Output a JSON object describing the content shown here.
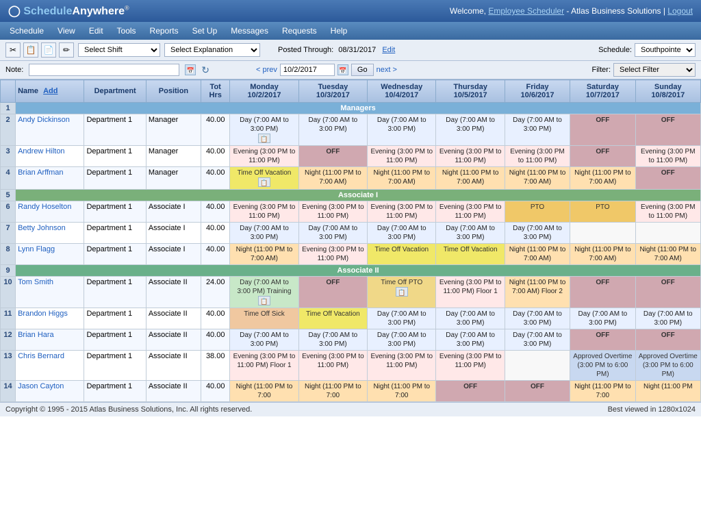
{
  "app": {
    "title": "Schedule Anywhere",
    "logo_text": "Schedule",
    "logo_highlight": "Anywhere",
    "logo_symbol": "®"
  },
  "header": {
    "welcome": "Welcome,",
    "user_link": "Employee Scheduler",
    "company": "- Atlas Business Solutions |",
    "logout": "Logout"
  },
  "nav": {
    "items": [
      "Schedule",
      "View",
      "Edit",
      "Tools",
      "Reports",
      "Set Up",
      "Messages",
      "Requests",
      "Help"
    ]
  },
  "toolbar": {
    "shift_placeholder": "Select Shift",
    "explanation_placeholder": "Select Explanation",
    "posted_label": "Posted Through:",
    "posted_date": "08/31/2017",
    "edit_link": "Edit",
    "schedule_label": "Schedule:",
    "schedule_value": "Southpointe",
    "filter_label": "Filter:",
    "filter_value": "Select Filter"
  },
  "date_nav": {
    "prev": "< prev",
    "current_date": "10/2/2017",
    "go": "Go",
    "next": "next >"
  },
  "note": {
    "label": "Note:"
  },
  "table": {
    "headers": {
      "row_num": "",
      "name": "Name",
      "add": "Add",
      "department": "Department",
      "position": "Position",
      "tot_hrs": "Tot Hrs",
      "monday": "Monday\n10/2/2017",
      "tuesday": "Tuesday\n10/3/2017",
      "wednesday": "Wednesday\n10/4/2017",
      "thursday": "Thursday\n10/5/2017",
      "friday": "Friday\n10/6/2017",
      "saturday": "Saturday\n10/7/2017",
      "sunday": "Sunday\n10/8/2017"
    },
    "sections": [
      {
        "id": 1,
        "label": "Managers",
        "type": "managers",
        "rows": [
          {
            "num": 2,
            "name": "Andy Dickinson",
            "department": "Department 1",
            "position": "Manager",
            "tot_hrs": "40.00",
            "monday": "Day (7:00 AM to 3:00 PM)",
            "monday_type": "day",
            "monday_icon": true,
            "tuesday": "Day (7:00 AM to 3:00 PM)",
            "tuesday_type": "day",
            "wednesday": "Day (7:00 AM to 3:00 PM)",
            "wednesday_type": "day",
            "thursday": "Day (7:00 AM to 3:00 PM)",
            "thursday_type": "day",
            "friday": "Day (7:00 AM to 3:00 PM)",
            "friday_type": "day",
            "saturday": "OFF",
            "saturday_type": "off",
            "sunday": "OFF",
            "sunday_type": "off"
          },
          {
            "num": 3,
            "name": "Andrew Hilton",
            "department": "Department 1",
            "position": "Manager",
            "tot_hrs": "40.00",
            "monday": "Evening (3:00 PM to 11:00 PM)",
            "monday_type": "evening",
            "tuesday": "OFF",
            "tuesday_type": "off",
            "wednesday": "Evening (3:00 PM to 11:00 PM)",
            "wednesday_type": "evening",
            "thursday": "Evening (3:00 PM to 11:00 PM)",
            "thursday_type": "evening",
            "friday": "Evening (3:00 PM to 11:00 PM)",
            "friday_type": "evening",
            "saturday": "OFF",
            "saturday_type": "off",
            "sunday": "Evening (3:00 PM to 11:00 PM)",
            "sunday_type": "evening"
          },
          {
            "num": 4,
            "name": "Brian Arffman",
            "department": "Department 1",
            "position": "Manager",
            "tot_hrs": "40.00",
            "monday": "Time Off Vacation",
            "monday_type": "vacation",
            "monday_icon": true,
            "tuesday": "Night (11:00 PM to 7:00 AM)",
            "tuesday_type": "night",
            "wednesday": "Night (11:00 PM to 7:00 AM)",
            "wednesday_type": "night",
            "thursday": "Night (11:00 PM to 7:00 AM)",
            "thursday_type": "night",
            "friday": "Night (11:00 PM to 7:00 AM)",
            "friday_type": "night",
            "saturday": "Night (11:00 PM to 7:00 AM)",
            "saturday_type": "night",
            "sunday": "OFF",
            "sunday_type": "off"
          }
        ]
      },
      {
        "id": 5,
        "label": "Associate I",
        "type": "associate1",
        "rows": [
          {
            "num": 6,
            "name": "Randy Hoselton",
            "department": "Department 1",
            "position": "Associate I",
            "tot_hrs": "40.00",
            "monday": "Evening (3:00 PM to 11:00 PM)",
            "monday_type": "evening",
            "tuesday": "Evening (3:00 PM to 11:00 PM)",
            "tuesday_type": "evening",
            "wednesday": "Evening (3:00 PM to 11:00 PM)",
            "wednesday_type": "evening",
            "thursday": "Evening (3:00 PM to 11:00 PM)",
            "thursday_type": "evening",
            "friday": "PTO",
            "friday_type": "pto",
            "saturday": "PTO",
            "saturday_type": "pto",
            "sunday": "Evening (3:00 PM to 11:00 PM)",
            "sunday_type": "evening"
          },
          {
            "num": 7,
            "name": "Betty Johnson",
            "department": "Department 1",
            "position": "Associate I",
            "tot_hrs": "40.00",
            "monday": "Day (7:00 AM to 3:00 PM)",
            "monday_type": "day",
            "tuesday": "Day (7:00 AM to 3:00 PM)",
            "tuesday_type": "day",
            "wednesday": "Day (7:00 AM to 3:00 PM)",
            "wednesday_type": "day",
            "thursday": "Day (7:00 AM to 3:00 PM)",
            "thursday_type": "day",
            "friday": "Day (7:00 AM to 3:00 PM)",
            "friday_type": "day",
            "saturday": "",
            "saturday_type": "empty",
            "sunday": "",
            "sunday_type": "empty"
          },
          {
            "num": 8,
            "name": "Lynn Flagg",
            "department": "Department 1",
            "position": "Associate I",
            "tot_hrs": "40.00",
            "monday": "Night (11:00 PM to 7:00 AM)",
            "monday_type": "night",
            "tuesday": "Evening (3:00 PM to 11:00 PM)",
            "tuesday_type": "evening",
            "wednesday": "Time Off Vacation",
            "wednesday_type": "vacation",
            "thursday": "Time Off Vacation",
            "thursday_type": "vacation",
            "friday": "Night (11:00 PM to 7:00 AM)",
            "friday_type": "night",
            "saturday": "Night (11:00 PM to 7:00 AM)",
            "saturday_type": "night",
            "sunday": "Night (11:00 PM to 7:00 AM)",
            "sunday_type": "night"
          }
        ]
      },
      {
        "id": 9,
        "label": "Associate II",
        "type": "associate2",
        "rows": [
          {
            "num": 10,
            "name": "Tom Smith",
            "department": "Department 1",
            "position": "Associate II",
            "tot_hrs": "24.00",
            "monday": "Day (7:00 AM to 3:00 PM) Training",
            "monday_type": "training",
            "monday_icon": true,
            "tuesday": "OFF",
            "tuesday_type": "off",
            "wednesday": "Time Off PTO",
            "wednesday_type": "pto-vacation",
            "wednesday_icon": true,
            "thursday": "Evening (3:00 PM to 11:00 PM) Floor 1",
            "thursday_type": "evening",
            "friday": "Night (11:00 PM to 7:00 AM) Floor 2",
            "friday_type": "night",
            "saturday": "OFF",
            "saturday_type": "off",
            "sunday": "OFF",
            "sunday_type": "off"
          },
          {
            "num": 11,
            "name": "Brandon Higgs",
            "department": "Department 1",
            "position": "Associate II",
            "tot_hrs": "40.00",
            "monday": "Time Off Sick",
            "monday_type": "sick",
            "tuesday": "Time Off Vacation",
            "tuesday_type": "vacation",
            "wednesday": "Day (7:00 AM to 3:00 PM)",
            "wednesday_type": "day",
            "thursday": "Day (7:00 AM to 3:00 PM)",
            "thursday_type": "day",
            "friday": "Day (7:00 AM to 3:00 PM)",
            "friday_type": "day",
            "saturday": "Day (7:00 AM to 3:00 PM)",
            "saturday_type": "day",
            "sunday": "Day (7:00 AM to 3:00 PM)",
            "sunday_type": "day"
          },
          {
            "num": 12,
            "name": "Brian Hara",
            "department": "Department 1",
            "position": "Associate II",
            "tot_hrs": "40.00",
            "monday": "Day (7:00 AM to 3:00 PM)",
            "monday_type": "day",
            "tuesday": "Day (7:00 AM to 3:00 PM)",
            "tuesday_type": "day",
            "wednesday": "Day (7:00 AM to 3:00 PM)",
            "wednesday_type": "day",
            "thursday": "Day (7:00 AM to 3:00 PM)",
            "thursday_type": "day",
            "friday": "Day (7:00 AM to 3:00 PM)",
            "friday_type": "day",
            "saturday": "OFF",
            "saturday_type": "off",
            "sunday": "OFF",
            "sunday_type": "off"
          },
          {
            "num": 13,
            "name": "Chris Bernard",
            "department": "Department 1",
            "position": "Associate II",
            "tot_hrs": "38.00",
            "monday": "Evening (3:00 PM to 11:00 PM) Floor 1",
            "monday_type": "evening",
            "tuesday": "Evening (3:00 PM to 11:00 PM)",
            "tuesday_type": "evening",
            "wednesday": "Evening (3:00 PM to 11:00 PM)",
            "wednesday_type": "evening",
            "thursday": "Evening (3:00 PM to 11:00 PM)",
            "thursday_type": "evening",
            "friday": "",
            "friday_type": "empty",
            "saturday": "Approved Overtime (3:00 PM to 6:00 PM)",
            "saturday_type": "approved-ot",
            "sunday": "Approved Overtime (3:00 PM to 6:00 PM)",
            "sunday_type": "approved-ot"
          },
          {
            "num": 14,
            "name": "Jason Cayton",
            "department": "Department 1",
            "position": "Associate II",
            "tot_hrs": "40.00",
            "monday": "Night (11:00 PM to 7:00",
            "monday_type": "night",
            "tuesday": "Night (11:00 PM to 7:00",
            "tuesday_type": "night",
            "wednesday": "Night (11:00 PM to 7:00",
            "wednesday_type": "night",
            "thursday": "OFF",
            "thursday_type": "off",
            "friday": "OFF",
            "friday_type": "off",
            "saturday": "Night (11:00 PM to 7:00",
            "saturday_type": "night",
            "sunday": "Night (11:00 PM",
            "sunday_type": "night"
          }
        ]
      }
    ]
  },
  "footer": {
    "copyright": "Copyright © 1995 - 2015 Atlas Business Solutions, Inc. All rights reserved.",
    "best_viewed": "Best viewed in 1280x1024"
  }
}
